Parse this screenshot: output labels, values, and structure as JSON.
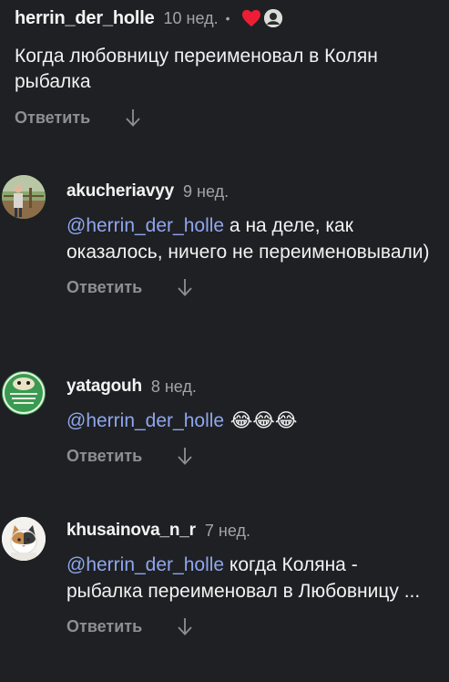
{
  "colors": {
    "background": "#1f2023",
    "mention": "#8fa6ee",
    "secondary_text": "#a3a4a8",
    "heart": "#ee1d36"
  },
  "top_comment": {
    "username": "herrin_der_holle",
    "time": "10 нед.",
    "separator": "•",
    "liked_icon": "heart-icon",
    "author_avatar_icon": "author-avatar-icon",
    "text": "Когда любовницу переименовал в Колян рыбалка",
    "reply_label": "Ответить",
    "arrow_icon": "arrow-down-icon"
  },
  "replies": [
    {
      "username": "akucheriavyy",
      "time": "9 нед.",
      "mention": "@herrin_der_holle",
      "text": " а на деле, как оказалось, ничего не переименовывали)",
      "reply_label": "Ответить"
    },
    {
      "username": "yatagouh",
      "time": "8 нед.",
      "mention": "@herrin_der_holle",
      "text": " 😂😂😂",
      "reply_label": "Ответить"
    },
    {
      "username": "khusainova_n_r",
      "time": "7 нед.",
      "mention": "@herrin_der_holle",
      "text": " когда Коляна - рыбалка переименовал в Любовницу ...",
      "reply_label": "Ответить"
    }
  ]
}
